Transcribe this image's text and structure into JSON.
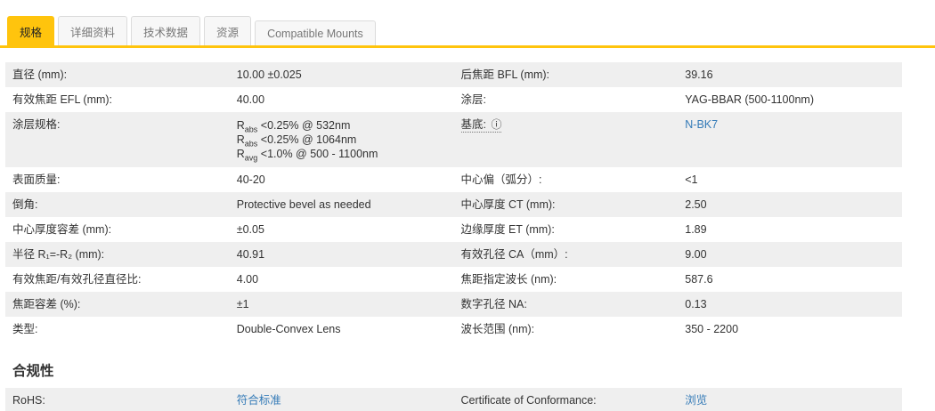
{
  "colors": {
    "accent_yellow": "#ffc40d",
    "link_blue": "#337ab7",
    "row_stripe_gray": "#efefef",
    "inactive_tab_gray": "#f7f7f7"
  },
  "tabs": [
    {
      "label": "规格",
      "active": true
    },
    {
      "label": "详细资料",
      "active": false
    },
    {
      "label": "技术数据",
      "active": false
    },
    {
      "label": "资源",
      "active": false
    },
    {
      "label": "Compatible Mounts",
      "active": false
    }
  ],
  "spec_rows": [
    {
      "left": {
        "label": "直径 (mm):",
        "value": "10.00 ±0.025"
      },
      "right": {
        "label": "后焦距 BFL (mm):",
        "value": "39.16"
      }
    },
    {
      "left": {
        "label": "有效焦距 EFL (mm):",
        "value": "40.00"
      },
      "right": {
        "label": "涂层:",
        "value": "YAG-BBAR (500-1100nm)"
      }
    },
    {
      "left": {
        "label": "涂层规格:",
        "lines": [
          {
            "base": "R",
            "sub": "abs",
            "rest": " <0.25% @ 532nm"
          },
          {
            "base": "R",
            "sub": "abs",
            "rest": " <0.25% @ 1064nm"
          },
          {
            "base": "R",
            "sub": "avg",
            "rest": " <1.0% @ 500 - 1100nm"
          }
        ]
      },
      "right": {
        "label": "基底:",
        "info_icon": "ⓘ",
        "value": "N-BK7"
      }
    },
    {
      "left": {
        "label": "表面质量:",
        "value": "40-20"
      },
      "right": {
        "label": "中心偏（弧分）:",
        "value": "<1"
      }
    },
    {
      "left": {
        "label": "倒角:",
        "value": "Protective bevel as needed"
      },
      "right": {
        "label": "中心厚度 CT (mm):",
        "value": "2.50"
      }
    },
    {
      "left": {
        "label": "中心厚度容差 (mm):",
        "value": "±0.05"
      },
      "right": {
        "label": "边缘厚度 ET (mm):",
        "value": "1.89"
      }
    },
    {
      "left": {
        "label": "半径 R₁=-R₂ (mm):",
        "value": "40.91"
      },
      "right": {
        "label": "有效孔径 CA（mm）:",
        "value": "9.00"
      }
    },
    {
      "left": {
        "label": "有效焦距/有效孔径直径比:",
        "value": "4.00"
      },
      "right": {
        "label": "焦距指定波长 (nm):",
        "value": "587.6"
      }
    },
    {
      "left": {
        "label": "焦距容差 (%):",
        "value": "±1"
      },
      "right": {
        "label": "数字孔径 NA:",
        "value": "0.13"
      }
    },
    {
      "left": {
        "label": "类型:",
        "value": "Double-Convex Lens"
      },
      "right": {
        "label": "波长范围 (nm):",
        "value": "350 - 2200"
      }
    }
  ],
  "compliance": {
    "heading": "合规性",
    "left": {
      "label": "RoHS:",
      "value": "符合标准"
    },
    "right": {
      "label": "Certificate of Conformance:",
      "value": "浏览"
    }
  }
}
